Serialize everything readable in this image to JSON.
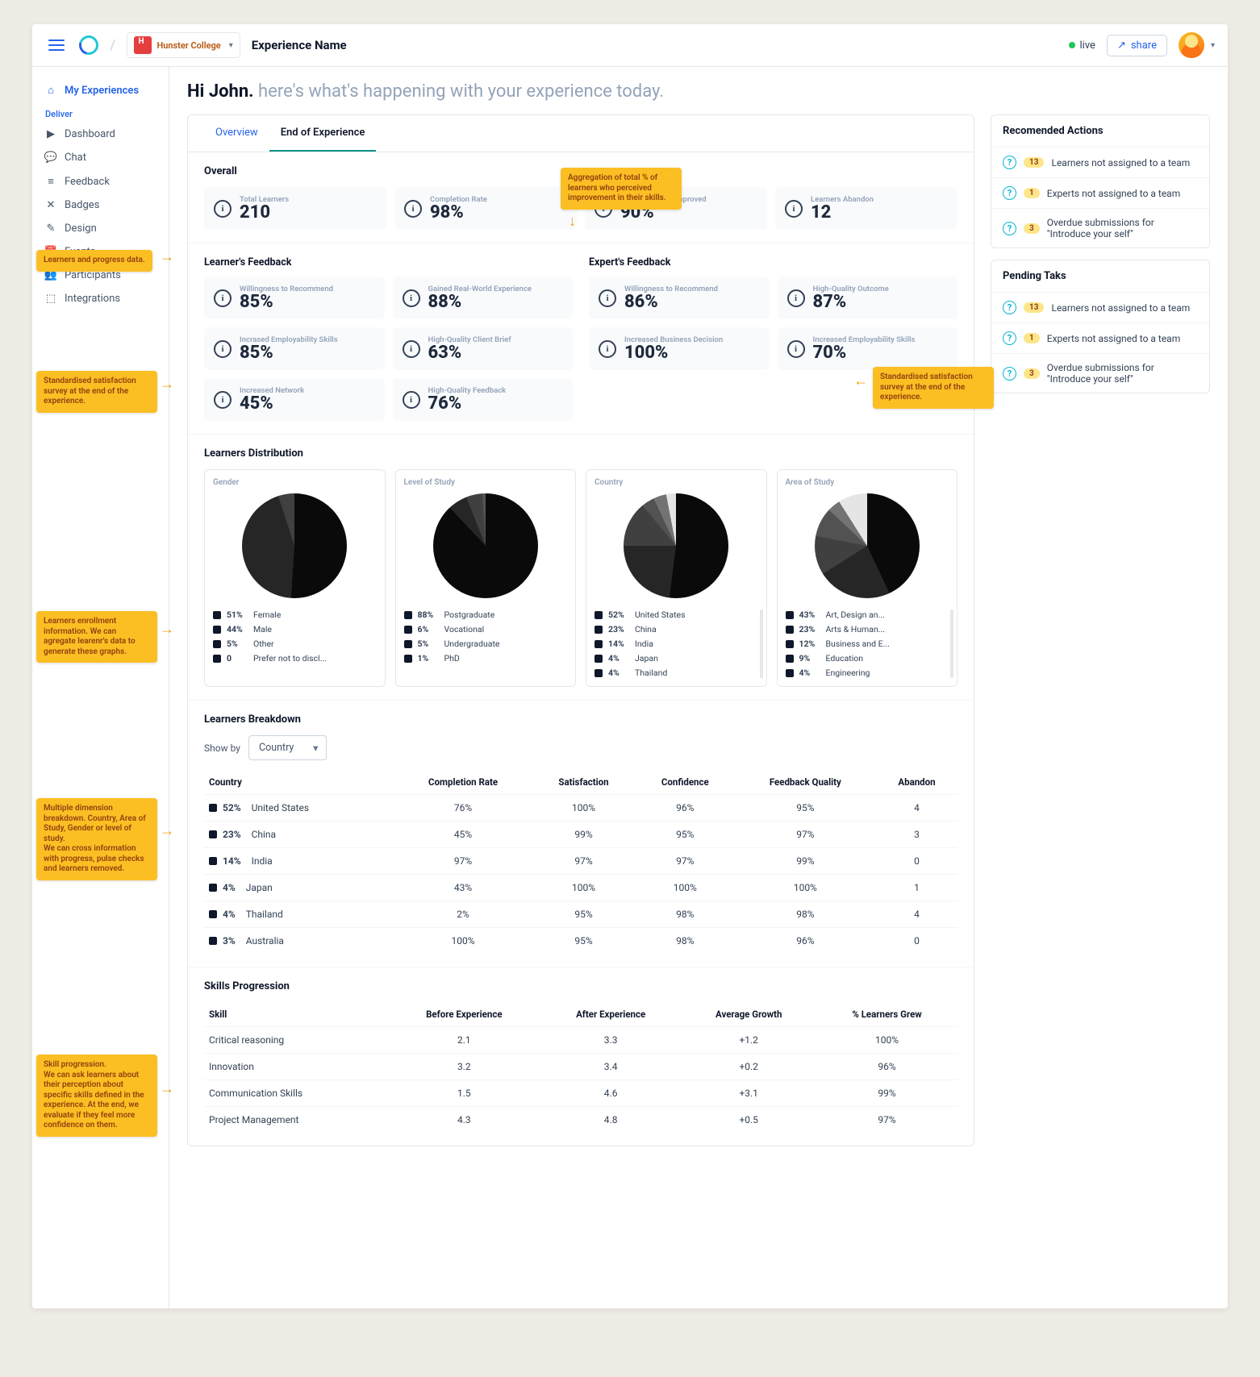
{
  "header": {
    "college_name": "Hunster College",
    "experience_name": "Experience Name",
    "live_label": "live",
    "share_label": "share"
  },
  "sidebar": {
    "active": "My Experiences",
    "heading": "Deliver",
    "items": [
      "Dashboard",
      "Chat",
      "Feedback",
      "Badges",
      "Design",
      "Events",
      "Participants",
      "Integrations"
    ]
  },
  "greeting": {
    "hi": "Hi John.",
    "sub": "here's what's happening with your experience today."
  },
  "tabs": {
    "overview": "Overview",
    "end": "End of Experience"
  },
  "overall": {
    "title": "Overall",
    "stats": [
      {
        "label": "Total Learners",
        "value": "210"
      },
      {
        "label": "Completion Rate",
        "value": "98%"
      },
      {
        "label": "Learner's Skills Improved",
        "value": "90%"
      },
      {
        "label": "Learners Abandon",
        "value": "12"
      }
    ]
  },
  "learner_fb": {
    "title": "Learner's Feedback",
    "stats": [
      {
        "label": "Willingness to Recommend",
        "value": "85%"
      },
      {
        "label": "Gained Real-World Experience",
        "value": "88%"
      },
      {
        "label": "Incrased Employability Skills",
        "value": "85%"
      },
      {
        "label": "High-Quality Client Brief",
        "value": "63%"
      },
      {
        "label": "Increased Network",
        "value": "45%"
      },
      {
        "label": "High-Quality Feedback",
        "value": "76%"
      }
    ]
  },
  "expert_fb": {
    "title": "Expert's Feedback",
    "stats": [
      {
        "label": "Willingness to Recommend",
        "value": "86%"
      },
      {
        "label": "High-Quality Outcome",
        "value": "87%"
      },
      {
        "label": "Increased Business Decision",
        "value": "100%"
      },
      {
        "label": "Increased Employability Skills",
        "value": "70%"
      }
    ]
  },
  "distribution": {
    "title": "Learners Distribution",
    "cards": [
      {
        "title": "Gender",
        "items": [
          {
            "pct": "51%",
            "lbl": "Female"
          },
          {
            "pct": "44%",
            "lbl": "Male"
          },
          {
            "pct": "5%",
            "lbl": "Other"
          },
          {
            "pct": "0",
            "lbl": "Prefer not to discl..."
          }
        ]
      },
      {
        "title": "Level of Study",
        "items": [
          {
            "pct": "88%",
            "lbl": "Postgraduate"
          },
          {
            "pct": "6%",
            "lbl": "Vocational"
          },
          {
            "pct": "5%",
            "lbl": "Undergraduate"
          },
          {
            "pct": "1%",
            "lbl": "PhD"
          }
        ]
      },
      {
        "title": "Country",
        "items": [
          {
            "pct": "52%",
            "lbl": "United States"
          },
          {
            "pct": "23%",
            "lbl": "China"
          },
          {
            "pct": "14%",
            "lbl": "India"
          },
          {
            "pct": "4%",
            "lbl": "Japan"
          },
          {
            "pct": "4%",
            "lbl": "Thailand"
          }
        ],
        "scroll": true
      },
      {
        "title": "Area of Study",
        "items": [
          {
            "pct": "43%",
            "lbl": "Art, Design an..."
          },
          {
            "pct": "23%",
            "lbl": "Arts & Human..."
          },
          {
            "pct": "12%",
            "lbl": "Business and E..."
          },
          {
            "pct": "9%",
            "lbl": "Education"
          },
          {
            "pct": "4%",
            "lbl": "Engineering"
          }
        ],
        "scroll": true
      }
    ]
  },
  "breakdown": {
    "title": "Learners Breakdown",
    "showby_label": "Show by",
    "showby_value": "Country",
    "columns": [
      "Country",
      "Completion Rate",
      "Satisfaction",
      "Confidence",
      "Feedback Quality",
      "Abandon"
    ],
    "rows": [
      {
        "pct": "52%",
        "name": "United States",
        "v": [
          "76%",
          "100%",
          "96%",
          "95%",
          "4"
        ]
      },
      {
        "pct": "23%",
        "name": "China",
        "v": [
          "45%",
          "99%",
          "95%",
          "97%",
          "3"
        ]
      },
      {
        "pct": "14%",
        "name": "India",
        "v": [
          "97%",
          "97%",
          "97%",
          "99%",
          "0"
        ]
      },
      {
        "pct": "4%",
        "name": "Japan",
        "v": [
          "43%",
          "100%",
          "100%",
          "100%",
          "1"
        ]
      },
      {
        "pct": "4%",
        "name": "Thailand",
        "v": [
          "2%",
          "95%",
          "98%",
          "98%",
          "4"
        ]
      },
      {
        "pct": "3%",
        "name": "Australia",
        "v": [
          "100%",
          "95%",
          "98%",
          "96%",
          "0"
        ]
      }
    ]
  },
  "skills": {
    "title": "Skills Progression",
    "columns": [
      "Skill",
      "Before Experience",
      "After Experience",
      "Average Growth",
      "% Learners Grew"
    ],
    "rows": [
      {
        "name": "Critical reasoning",
        "v": [
          "2.1",
          "3.3",
          "+1.2",
          "100%"
        ]
      },
      {
        "name": "Innovation",
        "v": [
          "3.2",
          "3.4",
          "+0.2",
          "96%"
        ]
      },
      {
        "name": "Communication Skills",
        "v": [
          "1.5",
          "4.6",
          "+3.1",
          "99%"
        ]
      },
      {
        "name": "Project Management",
        "v": [
          "4.3",
          "4.8",
          "+0.5",
          "97%"
        ]
      }
    ]
  },
  "recommended": {
    "title": "Recomended Actions",
    "items": [
      {
        "badge": "13",
        "text": "Learners not assigned to a team"
      },
      {
        "badge": "1",
        "text": "Experts not assigned to a team"
      },
      {
        "badge": "3",
        "text": "Overdue submissions for \"Introduce your self\""
      }
    ]
  },
  "pending": {
    "title": "Pending Taks",
    "items": [
      {
        "badge": "13",
        "text": "Learners not assigned to a team"
      },
      {
        "badge": "1",
        "text": "Experts not assigned to a team"
      },
      {
        "badge": "3",
        "text": "Overdue submissions for \"Introduce your self\""
      }
    ]
  },
  "annotations": {
    "a1": "Learners and progress data.",
    "a2": "Aggregation of total % of learners who perceived improvement in their skills.",
    "a3": "Standardised satisfaction survey at the end of the experience.",
    "a4": "Standardised satisfaction survey at the end of the experience.",
    "a5": "Learners enrollment information. We can agregate learenr's data to generate these graphs.",
    "a6": "Multiple dimension breakdown. Country, Area of Study, Gender or level of study.\nWe can cross information with progress, pulse checks and learners removed.",
    "a7": "Skill progression.\nWe can ask learners about their perception about specific skills defined in the experience. At the end, we evaluate if they feel more confidence on them."
  },
  "chart_data": [
    {
      "type": "pie",
      "title": "Gender",
      "series": [
        {
          "name": "Female",
          "value": 51
        },
        {
          "name": "Male",
          "value": 44
        },
        {
          "name": "Other",
          "value": 5
        },
        {
          "name": "Prefer not to disclose",
          "value": 0
        }
      ]
    },
    {
      "type": "pie",
      "title": "Level of Study",
      "series": [
        {
          "name": "Postgraduate",
          "value": 88
        },
        {
          "name": "Vocational",
          "value": 6
        },
        {
          "name": "Undergraduate",
          "value": 5
        },
        {
          "name": "PhD",
          "value": 1
        }
      ]
    },
    {
      "type": "pie",
      "title": "Country",
      "series": [
        {
          "name": "United States",
          "value": 52
        },
        {
          "name": "China",
          "value": 23
        },
        {
          "name": "India",
          "value": 14
        },
        {
          "name": "Japan",
          "value": 4
        },
        {
          "name": "Thailand",
          "value": 4
        }
      ]
    },
    {
      "type": "pie",
      "title": "Area of Study",
      "series": [
        {
          "name": "Art, Design and Architecture",
          "value": 43
        },
        {
          "name": "Arts & Humanities",
          "value": 23
        },
        {
          "name": "Business and Economics",
          "value": 12
        },
        {
          "name": "Education",
          "value": 9
        },
        {
          "name": "Engineering",
          "value": 4
        }
      ]
    }
  ]
}
